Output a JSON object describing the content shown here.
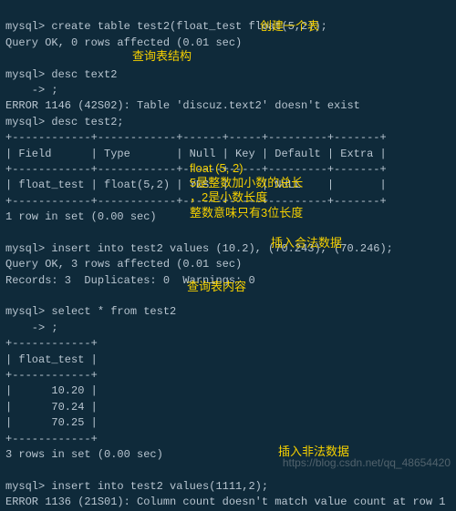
{
  "sql": {
    "create_cmd": "mysql> create table test2(float_test float(5,2));",
    "create_resp": "Query OK, 0 rows affected (0.01 sec)",
    "desc_text2_cmd": "mysql> desc text2",
    "cont_arrow": "    -> ;",
    "desc_text2_err": "ERROR 1146 (42S02): Table 'discuz.text2' doesn't exist",
    "desc_test2_cmd": "mysql> desc test2;",
    "desc_sep": "+------------+------------+------+-----+---------+-------+",
    "desc_hdr": "| Field      | Type       | Null | Key | Default | Extra |",
    "desc_row": "| float_test | float(5,2) | YES  |     | NULL    |       |",
    "rows1": "1 row in set (0.00 sec)",
    "insert_ok_cmd": "mysql> insert into test2 values (10.2), (70.243), (70.246);",
    "insert_ok_resp": "Query OK, 3 rows affected (0.01 sec)",
    "insert_ok_info": "Records: 3  Duplicates: 0  Warnings: 0",
    "select_cmd": "mysql> select * from test2",
    "sel_sep": "+------------+",
    "sel_hdr": "| float_test |",
    "sel_r1": "|      10.20 |",
    "sel_r2": "|      70.24 |",
    "sel_r3": "|      70.25 |",
    "rows3": "3 rows in set (0.00 sec)",
    "insert_bad_cmd": "mysql> insert into test2 values(1111,2);",
    "insert_bad_err": "ERROR 1136 (21S01): Column count doesn't match value count at row 1"
  },
  "ann": {
    "create": "创建一个表",
    "desc": "查询表结构",
    "float1": "float (5, 2)",
    "float2": "5是整数加小数的总长",
    "float3": "，2是小数长度",
    "float4": "整数意味只有3位长度",
    "insert_ok": "插入合法数据",
    "select": "查询表内容",
    "insert_bad": "插入非法数据"
  },
  "watermark": "https://blog.csdn.net/qq_48654420"
}
